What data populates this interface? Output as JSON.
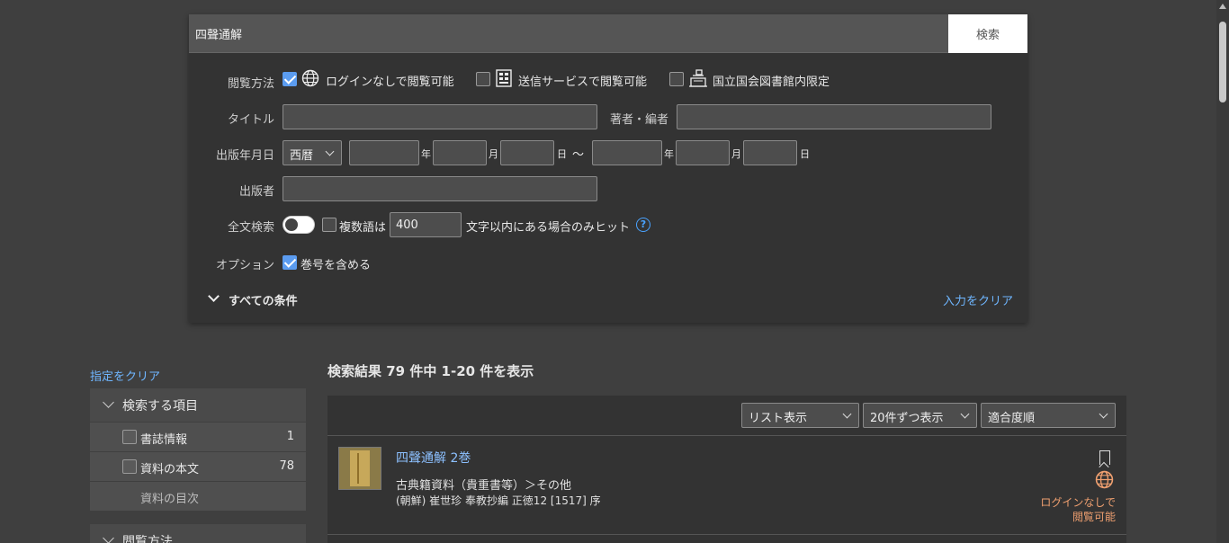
{
  "search": {
    "query": "四聲通解",
    "button_label": "検索"
  },
  "form": {
    "access_label": "閲覧方法",
    "access_options": [
      {
        "label": "ログインなしで閲覧可能",
        "checked": true,
        "icon": "globe-icon"
      },
      {
        "label": "送信サービスで閲覧可能",
        "checked": false,
        "icon": "building-icon"
      },
      {
        "label": "国立国会図書館内限定",
        "checked": false,
        "icon": "library-desk-icon"
      }
    ],
    "title_label": "タイトル",
    "title_value": "",
    "author_label": "著者・編者",
    "author_value": "",
    "date_label": "出版年月日",
    "era_value": "西暦",
    "year_unit": "年",
    "month_unit": "月",
    "day_unit": "日",
    "range_sep": "〜",
    "publisher_label": "出版者",
    "publisher_value": "",
    "fulltext_label": "全文検索",
    "fulltext_enabled": false,
    "multiword_label": "複数語は",
    "multiword_checked": false,
    "char_limit": "400",
    "char_limit_suffix": "文字以内にある場合のみヒット",
    "help_glyph": "?",
    "option_label": "オプション",
    "include_volume_label": "巻号を含める",
    "include_volume_checked": true,
    "all_conditions_label": "すべての条件",
    "clear_input_label": "入力をクリア"
  },
  "sidebar": {
    "clear_label": "指定をクリア",
    "section1_title": "検索する項目",
    "items": [
      {
        "label": "書誌情報",
        "count": "1"
      },
      {
        "label": "資料の本文",
        "count": "78"
      }
    ],
    "toc_label": "資料の目次",
    "section2_title": "閲覧方法"
  },
  "results": {
    "summary": "検索結果 79 件中 1-20 件を表示",
    "view_mode": "リスト表示",
    "per_page": "20件ずつ表示",
    "sort": "適合度順",
    "items": [
      {
        "title": "四聲通解 2巻",
        "category": "古典籍資料（貴重書等）＞その他",
        "meta": "(朝鮮) 崔世珍 奉教抄編 正徳12 [1517] 序",
        "access_line1": "ログインなしで",
        "access_line2": "閲覧可能"
      }
    ]
  },
  "colors": {
    "accent_blue": "#5b9cf0",
    "link_blue": "#6fb6ff",
    "access_orange": "#f0a070"
  }
}
